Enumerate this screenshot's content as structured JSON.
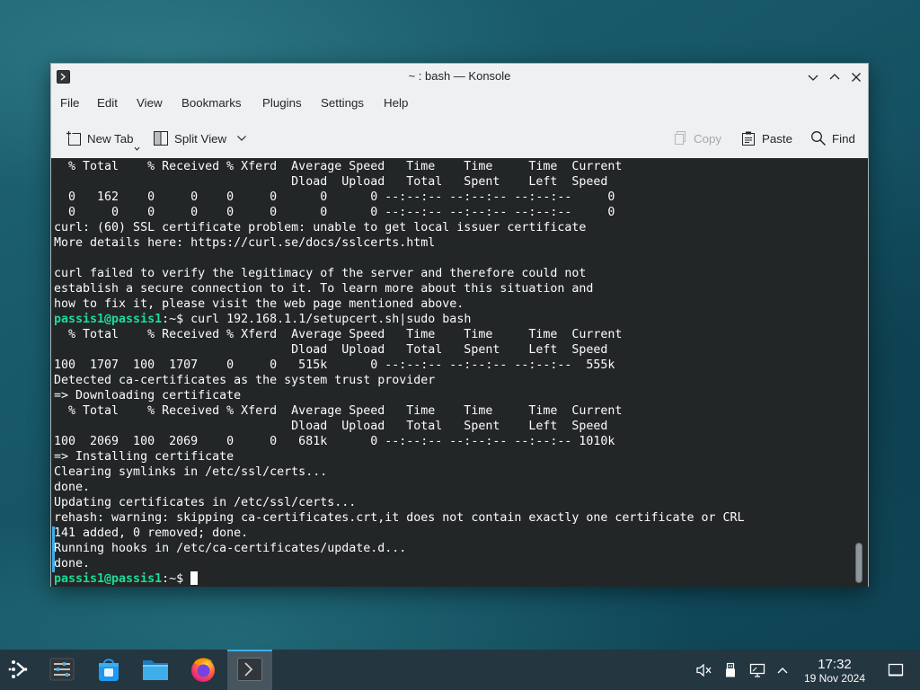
{
  "window": {
    "title": "~ : bash — Konsole",
    "app_icon": "konsole-icon",
    "buttons": [
      "minimize-chevron-down-icon",
      "maximize-chevron-up-icon",
      "close-icon"
    ]
  },
  "menu": [
    {
      "label": "File"
    },
    {
      "label": "Edit"
    },
    {
      "label": "View"
    },
    {
      "label": "Bookmarks"
    },
    {
      "label": "Plugins"
    },
    {
      "label": "Settings"
    },
    {
      "label": "Help"
    }
  ],
  "toolbar": {
    "new_tab": "New Tab",
    "split_view": "Split View",
    "copy": "Copy",
    "paste": "Paste",
    "find": "Find"
  },
  "terminal": {
    "lines": [
      {
        "segments": [
          {
            "text": "  % Total    % Received % Xferd  Average Speed   Time    Time     Time  Current",
            "style": "plain"
          }
        ]
      },
      {
        "segments": [
          {
            "text": "                                 Dload  Upload   Total   Spent    Left  Speed",
            "style": "plain"
          }
        ]
      },
      {
        "segments": [
          {
            "text": "  0   162    0     0    0     0      0      0 --:--:-- --:--:-- --:--:--     0",
            "style": "plain"
          }
        ]
      },
      {
        "segments": [
          {
            "text": "  0     0    0     0    0     0      0      0 --:--:-- --:--:-- --:--:--     0",
            "style": "plain"
          }
        ]
      },
      {
        "segments": [
          {
            "text": "curl: (60) SSL certificate problem: unable to get local issuer certificate",
            "style": "plain"
          }
        ]
      },
      {
        "segments": [
          {
            "text": "More details here: https://curl.se/docs/sslcerts.html",
            "style": "plain"
          }
        ]
      },
      {
        "segments": []
      },
      {
        "segments": [
          {
            "text": "curl failed to verify the legitimacy of the server and therefore could not",
            "style": "plain"
          }
        ]
      },
      {
        "segments": [
          {
            "text": "establish a secure connection to it. To learn more about this situation and",
            "style": "plain"
          }
        ]
      },
      {
        "segments": [
          {
            "text": "how to fix it, please visit the web page mentioned above.",
            "style": "plain"
          }
        ]
      },
      {
        "segments": [
          {
            "text": "passis1@passis1",
            "style": "prompt-user"
          },
          {
            "text": ":~$ curl 192.168.1.1/setupcert.sh|sudo bash",
            "style": "plain"
          }
        ]
      },
      {
        "segments": [
          {
            "text": "  % Total    % Received % Xferd  Average Speed   Time    Time     Time  Current",
            "style": "plain"
          }
        ]
      },
      {
        "segments": [
          {
            "text": "                                 Dload  Upload   Total   Spent    Left  Speed",
            "style": "plain"
          }
        ]
      },
      {
        "segments": [
          {
            "text": "100  1707  100  1707    0     0   515k      0 --:--:-- --:--:-- --:--:--  555k",
            "style": "plain"
          }
        ]
      },
      {
        "segments": [
          {
            "text": "Detected ca-certificates as the system trust provider",
            "style": "plain"
          }
        ]
      },
      {
        "segments": [
          {
            "text": "=> Downloading certificate",
            "style": "plain"
          }
        ]
      },
      {
        "segments": [
          {
            "text": "  % Total    % Received % Xferd  Average Speed   Time    Time     Time  Current",
            "style": "plain"
          }
        ]
      },
      {
        "segments": [
          {
            "text": "                                 Dload  Upload   Total   Spent    Left  Speed",
            "style": "plain"
          }
        ]
      },
      {
        "segments": [
          {
            "text": "100  2069  100  2069    0     0   681k      0 --:--:-- --:--:-- --:--:-- 1010k",
            "style": "plain"
          }
        ]
      },
      {
        "segments": [
          {
            "text": "=> Installing certificate",
            "style": "plain"
          }
        ]
      },
      {
        "segments": [
          {
            "text": "Clearing symlinks in /etc/ssl/certs...",
            "style": "plain"
          }
        ]
      },
      {
        "segments": [
          {
            "text": "done.",
            "style": "plain"
          }
        ]
      },
      {
        "segments": [
          {
            "text": "Updating certificates in /etc/ssl/certs...",
            "style": "plain"
          }
        ]
      },
      {
        "segments": [
          {
            "text": "rehash: warning: skipping ca-certificates.crt,it does not contain exactly one certificate or CRL",
            "style": "plain"
          }
        ]
      },
      {
        "segments": [
          {
            "text": "141 added, 0 removed; done.",
            "style": "plain"
          }
        ]
      },
      {
        "segments": [
          {
            "text": "Running hooks in /etc/ca-certificates/update.d...",
            "style": "plain"
          }
        ]
      },
      {
        "segments": [
          {
            "text": "done.",
            "style": "plain"
          }
        ]
      },
      {
        "segments": [
          {
            "text": "passis1@passis1",
            "style": "prompt-user"
          },
          {
            "text": ":~$ ",
            "style": "plain"
          }
        ],
        "cursor": true
      }
    ]
  },
  "taskbar": {
    "apps": [
      {
        "icon": "application-launcher-icon",
        "active": false
      },
      {
        "icon": "system-settings-icon",
        "active": false
      },
      {
        "icon": "discover-store-icon",
        "active": false
      },
      {
        "icon": "dolphin-folder-icon",
        "active": false
      },
      {
        "icon": "firefox-icon",
        "active": false
      },
      {
        "icon": "konsole-icon",
        "active": true
      }
    ],
    "tray": [
      "speaker-muted-icon",
      "removable-drive-icon",
      "network-icon",
      "chevron-up-icon",
      "show-desktop-icon"
    ],
    "clock": {
      "time": "17:32",
      "date": "19 Nov 2024"
    }
  },
  "colors": {
    "terminal_bg": "#232627",
    "terminal_fg": "#fcfcfc",
    "prompt_user": "#1cdc9a",
    "accent": "#3daee9",
    "window_bg": "#eff0f1"
  }
}
